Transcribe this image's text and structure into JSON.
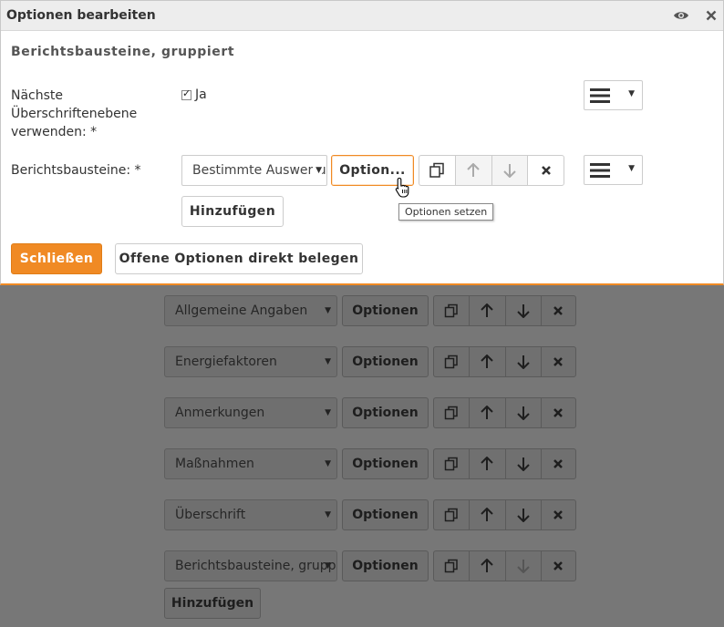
{
  "dialog": {
    "title": "Optionen bearbeiten",
    "section_heading": "Berichtsbausteine, gruppiert",
    "next_heading_label_line1": "Nächste",
    "next_heading_label_line2": "Überschriftenebene",
    "next_heading_label_line3": "verwenden: *",
    "checkbox_label": "Ja",
    "checkbox_checked": true,
    "modules_label": "Berichtsbausteine: *",
    "modules_select_value": "Bestimmte Auswertungen",
    "option_button": "Option...",
    "add_button": "Hinzufügen",
    "tooltip": "Optionen setzen",
    "close_button": "Schließen",
    "open_options_button": "Offene Optionen direkt belegen"
  },
  "colors": {
    "accent": "#f08a24",
    "overlay": "#777777"
  },
  "background": {
    "rows": [
      {
        "select_value": "Allgemeine Angaben",
        "options_label": "Optionen"
      },
      {
        "select_value": "Energiefaktoren",
        "options_label": "Optionen"
      },
      {
        "select_value": "Anmerkungen",
        "options_label": "Optionen"
      },
      {
        "select_value": "Maßnahmen",
        "options_label": "Optionen"
      },
      {
        "select_value": "Überschrift",
        "options_label": "Optionen"
      },
      {
        "select_value": "Berichtsbausteine, gruppiert",
        "options_label": "Optionen"
      }
    ],
    "add_button": "Hinzufügen"
  }
}
